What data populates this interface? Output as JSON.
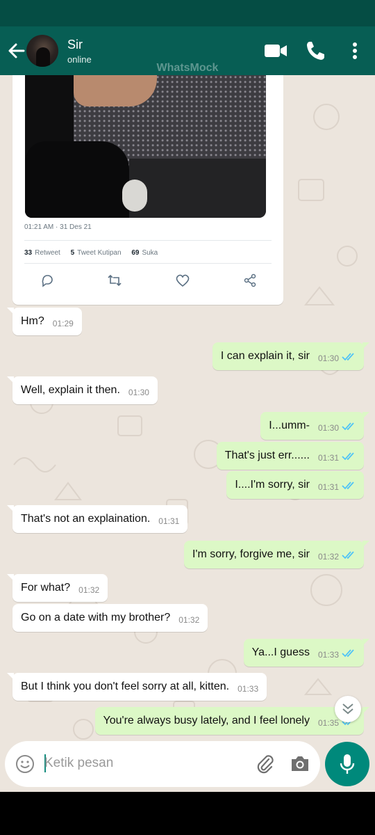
{
  "header": {
    "contact_name": "Sir",
    "status": "online",
    "watermark": "WhatsMock",
    "icons": [
      "back-arrow-icon",
      "video-call-icon",
      "voice-call-icon",
      "more-options-icon"
    ]
  },
  "tweet": {
    "timestamp": "01:21 AM · 31 Des 21",
    "retweets": "33",
    "retweets_label": "Retweet",
    "quotes": "5",
    "quotes_label": "Tweet Kutipan",
    "likes": "69",
    "likes_label": "Suka"
  },
  "messages": [
    {
      "dir": "in",
      "text": "Hm?",
      "time": "01:29"
    },
    {
      "dir": "out",
      "text": "I can explain it, sir",
      "time": "01:30"
    },
    {
      "dir": "in",
      "text": "Well, explain it then.",
      "time": "01:30"
    },
    {
      "dir": "out",
      "text": "I...umm-",
      "time": "01:30"
    },
    {
      "dir": "out",
      "text": "That's just err......",
      "time": "01:31"
    },
    {
      "dir": "out",
      "text": "I....I'm sorry, sir",
      "time": "01:31"
    },
    {
      "dir": "in",
      "text": "That's not an explaination.",
      "time": "01:31"
    },
    {
      "dir": "out",
      "text": "I'm sorry, forgive me, sir",
      "time": "01:32"
    },
    {
      "dir": "in",
      "text": "For what?",
      "time": "01:32"
    },
    {
      "dir": "in",
      "text": "Go on a date with my brother?",
      "time": "01:32"
    },
    {
      "dir": "out",
      "text": "Ya...I guess",
      "time": "01:33"
    },
    {
      "dir": "in",
      "text": "But I think you don't feel sorry at all, kitten.",
      "time": "01:33"
    },
    {
      "dir": "out",
      "text": "You're always busy lately, and I feel lonely",
      "time": "01:35"
    }
  ],
  "composer": {
    "placeholder": "Ketik pesan"
  },
  "colors": {
    "header": "#075e54",
    "statusbar": "#054d44",
    "chat_bg": "#ece5dd",
    "outgoing": "#dcf8c6",
    "incoming": "#ffffff",
    "read_ticks": "#4fc3f7",
    "mic_button": "#00897b"
  }
}
